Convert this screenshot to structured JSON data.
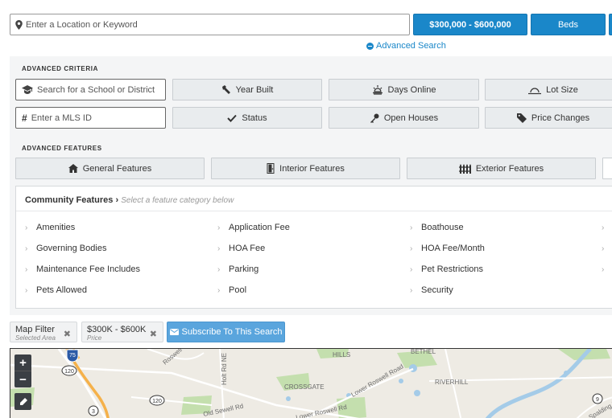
{
  "search": {
    "placeholder": "Enter a Location or Keyword",
    "price_label": "$300,000 - $600,000",
    "beds_label": "Beds",
    "advanced_link": "Advanced Search"
  },
  "criteria": {
    "title": "ADVANCED CRITERIA",
    "school_placeholder": "Search for a School or District",
    "mls_placeholder": "Enter a MLS ID",
    "buttons": {
      "year_built": "Year Built",
      "days_online": "Days Online",
      "lot_size": "Lot Size",
      "status": "Status",
      "open_houses": "Open Houses",
      "price_changes": "Price Changes"
    }
  },
  "features": {
    "title": "ADVANCED FEATURES",
    "tabs": [
      "General Features",
      "Interior Features",
      "Exterior Features"
    ],
    "community": {
      "heading": "Community Features",
      "separator": "›",
      "hint": "Select a feature category below",
      "items": [
        [
          "Amenities",
          "Application Fee",
          "Boathouse"
        ],
        [
          "Governing Bodies",
          "HOA Fee",
          "HOA Fee/Month"
        ],
        [
          "Maintenance Fee Includes",
          "Parking",
          "Pet Restrictions"
        ],
        [
          "Pets Allowed",
          "Pool",
          "Security"
        ]
      ]
    }
  },
  "filters": {
    "chips": [
      {
        "label": "Map Filter",
        "sub": "Selected Area"
      },
      {
        "label": "$300K - $600K",
        "sub": "Price"
      }
    ],
    "remove_glyph": "✖",
    "subscribe_label": "Subscribe To This Search"
  },
  "map": {
    "zoom_in": "+",
    "zoom_out": "−",
    "labels": {
      "hills": "HILLS",
      "bethel": "BETHEL",
      "riverhill": "RIVERHILL",
      "crossgate": "CROSSGATE",
      "lower_roswell_rd": "Lower Roswell Road",
      "lower_roswell_rd_2": "Lower Roswell Rd",
      "holt_rd": "Holt Rd NE",
      "old_sewell_rd": "Old Sewell Rd",
      "roswell": "Roswell",
      "spalding": "Spalding Dr"
    },
    "shields": [
      "75",
      "120",
      "120",
      "3",
      "9"
    ],
    "colors": {
      "water": "#a4cbe8",
      "park": "#c4dfae",
      "highway": "#f5b14a",
      "road": "#ffffff"
    }
  },
  "colors": {
    "accent": "#1a87c9",
    "subscribe": "#5aa5dd",
    "panel": "#f4f5f6"
  }
}
